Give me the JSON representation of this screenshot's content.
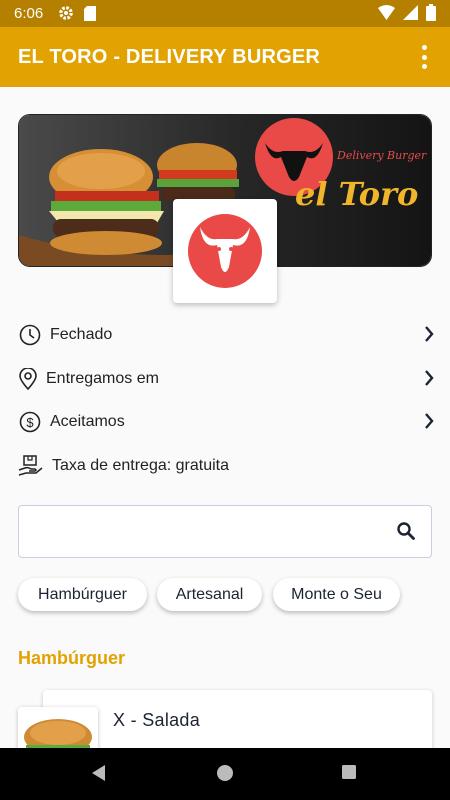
{
  "status_bar": {
    "time": "6:06"
  },
  "app_bar": {
    "title": "EL TORO - DELIVERY BURGER",
    "color": "#e2a302"
  },
  "banner": {
    "brand_script": "Delivery Burger",
    "brand_name": "el Toro"
  },
  "info": [
    {
      "label": "Fechado",
      "icon": "clock-icon"
    },
    {
      "label": "Entregamos em",
      "icon": "location-pin-icon"
    },
    {
      "label": "Aceitamos",
      "icon": "dollar-coin-icon"
    },
    {
      "label": "Taxa de entrega: gratuita",
      "icon": "delivery-hand-icon"
    }
  ],
  "search": {
    "value": "",
    "placeholder": ""
  },
  "categories": [
    "Hambúrguer",
    "Artesanal",
    "Monte o Seu"
  ],
  "section": {
    "title": "Hambúrguer"
  },
  "products": [
    {
      "name": "X - Salada"
    }
  ]
}
